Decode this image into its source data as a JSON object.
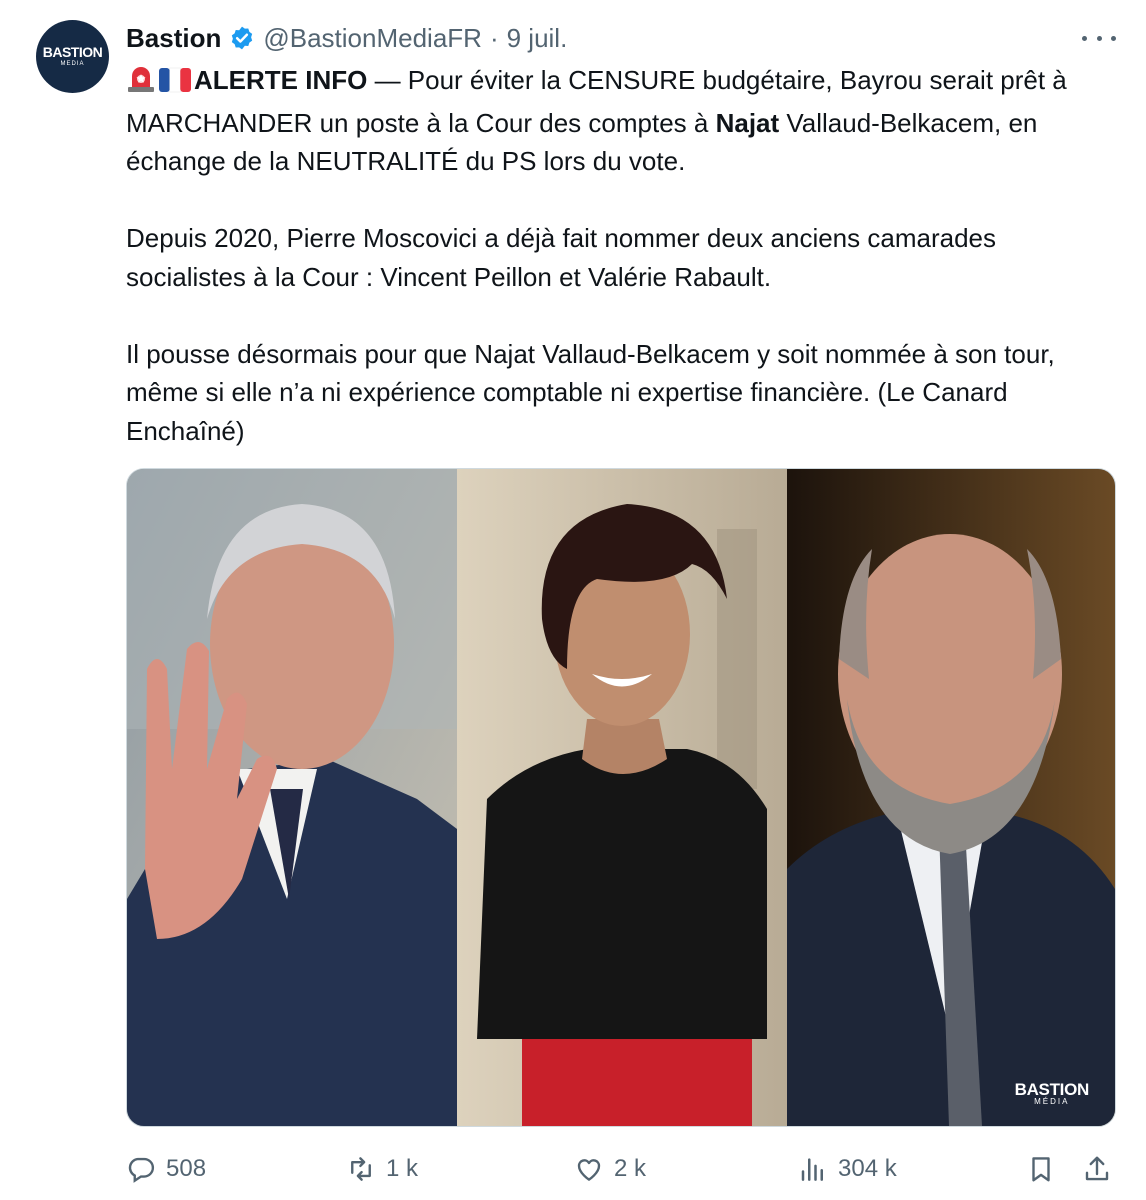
{
  "author": {
    "avatar_text_main": "BASTION",
    "avatar_text_sub": "MEDIA",
    "name": "Bastion",
    "handle": "@BastionMediaFR",
    "separator": "·",
    "date": "9 juil."
  },
  "tweet": {
    "p1_prefix": "ALERTE INFO",
    "p1_a": " — Pour éviter la CENSURE budgétaire, Bayrou serait prêt à MARCHANDER un poste à la Cour des comptes à ",
    "p1_bold": "Najat",
    "p1_b": " Vallaud-Belkacem, en échange de la NEUTRALITÉ du PS lors du vote.",
    "p2": "Depuis 2020, Pierre Moscovici a déjà fait nommer deux anciens camarades socialistes à la Cour : Vincent Peillon et Valérie Rabault.",
    "p3": "Il pousse désormais pour que Najat Vallaud-Belkacem y soit nommée à son tour, même si elle n’a ni expérience comptable ni expertise financière. (Le Canard Enchaîné)"
  },
  "media": {
    "watermark_main": "BASTION",
    "watermark_sub": "MÉDIA"
  },
  "actions": {
    "replies": "508",
    "reposts": "1 k",
    "likes": "2 k",
    "views": "304 k"
  },
  "icons": {
    "verified": "verified-badge-icon",
    "alert": "rotating-light-icon",
    "flag": "france-flag-icon",
    "more": "more-icon",
    "reply": "reply-icon",
    "repost": "repost-icon",
    "like": "heart-icon",
    "views": "views-icon",
    "bookmark": "bookmark-icon",
    "share": "share-icon"
  },
  "colors": {
    "text": "#0f1419",
    "secondary": "#536471",
    "verified": "#1d9bf0",
    "avatar_bg": "#152a45"
  }
}
